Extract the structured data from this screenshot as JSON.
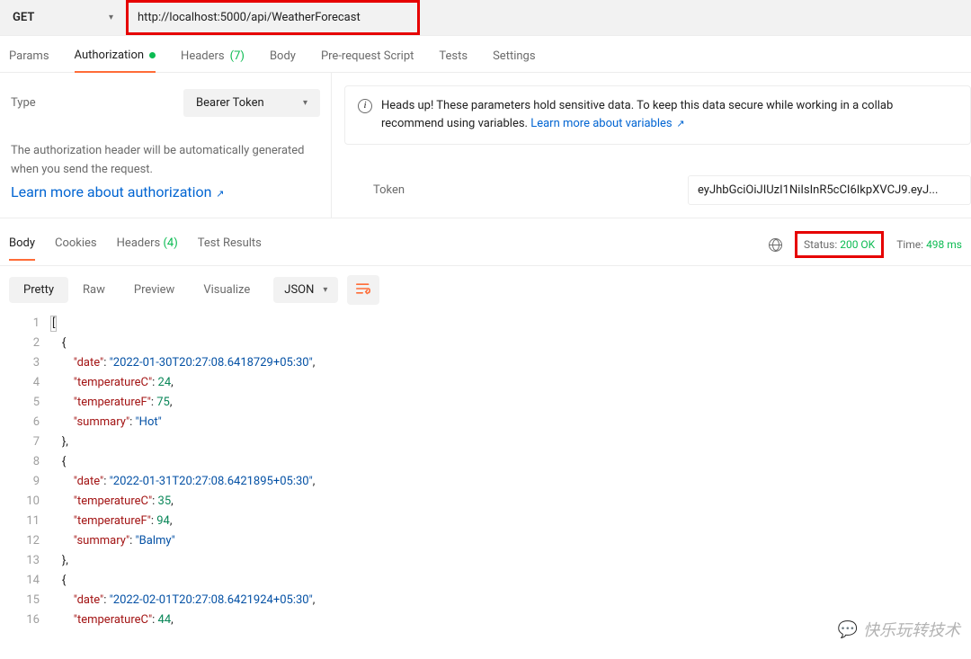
{
  "request": {
    "method": "GET",
    "url": "http://localhost:5000/api/WeatherForecast"
  },
  "req_tabs": {
    "params": "Params",
    "authorization": "Authorization",
    "headers": "Headers",
    "headers_count": "(7)",
    "body": "Body",
    "pre": "Pre-request Script",
    "tests": "Tests",
    "settings": "Settings"
  },
  "auth": {
    "type_label": "Type",
    "type_value": "Bearer Token",
    "desc": "The authorization header will be automatically generated when you send the request.",
    "learn_more": "Learn more about authorization",
    "notice": "Heads up! These parameters hold sensitive data. To keep this data secure while working in a collab recommend using variables.",
    "notice_link": "Learn more about variables",
    "token_label": "Token",
    "token_value": "eyJhbGciOiJIUzI1NiIsInR5cCI6IkpXVCJ9.eyJ..."
  },
  "resp_tabs": {
    "body": "Body",
    "cookies": "Cookies",
    "headers": "Headers",
    "headers_count": "(4)",
    "test_results": "Test Results"
  },
  "status": {
    "label": "Status:",
    "value": "200 OK",
    "time_label": "Time:",
    "time_value": "498 ms"
  },
  "view_controls": {
    "pretty": "Pretty",
    "raw": "Raw",
    "preview": "Preview",
    "visualize": "Visualize",
    "format": "JSON"
  },
  "code": {
    "lines": [
      {
        "n": 1,
        "html": "<span class='bracket-hl tok-punc'>[</span>"
      },
      {
        "n": 2,
        "html": "    <span class='tok-punc'>{</span>"
      },
      {
        "n": 3,
        "html": "        <span class='tok-key'>\"date\"</span><span class='tok-punc'>: </span><span class='tok-str'>\"2022-01-30T20:27:08.6418729+05:30\"</span><span class='tok-punc'>,</span>"
      },
      {
        "n": 4,
        "html": "        <span class='tok-key'>\"temperatureC\"</span><span class='tok-punc'>: </span><span class='tok-num'>24</span><span class='tok-punc'>,</span>"
      },
      {
        "n": 5,
        "html": "        <span class='tok-key'>\"temperatureF\"</span><span class='tok-punc'>: </span><span class='tok-num'>75</span><span class='tok-punc'>,</span>"
      },
      {
        "n": 6,
        "html": "        <span class='tok-key'>\"summary\"</span><span class='tok-punc'>: </span><span class='tok-str'>\"Hot\"</span>"
      },
      {
        "n": 7,
        "html": "    <span class='tok-punc'>},</span>"
      },
      {
        "n": 8,
        "html": "    <span class='tok-punc'>{</span>"
      },
      {
        "n": 9,
        "html": "        <span class='tok-key'>\"date\"</span><span class='tok-punc'>: </span><span class='tok-str'>\"2022-01-31T20:27:08.6421895+05:30\"</span><span class='tok-punc'>,</span>"
      },
      {
        "n": 10,
        "html": "        <span class='tok-key'>\"temperatureC\"</span><span class='tok-punc'>: </span><span class='tok-num'>35</span><span class='tok-punc'>,</span>"
      },
      {
        "n": 11,
        "html": "        <span class='tok-key'>\"temperatureF\"</span><span class='tok-punc'>: </span><span class='tok-num'>94</span><span class='tok-punc'>,</span>"
      },
      {
        "n": 12,
        "html": "        <span class='tok-key'>\"summary\"</span><span class='tok-punc'>: </span><span class='tok-str'>\"Balmy\"</span>"
      },
      {
        "n": 13,
        "html": "    <span class='tok-punc'>},</span>"
      },
      {
        "n": 14,
        "html": "    <span class='tok-punc'>{</span>"
      },
      {
        "n": 15,
        "html": "        <span class='tok-key'>\"date\"</span><span class='tok-punc'>: </span><span class='tok-str'>\"2022-02-01T20:27:08.6421924+05:30\"</span><span class='tok-punc'>,</span>"
      },
      {
        "n": 16,
        "html": "        <span class='tok-key'>\"temperatureC\"</span><span class='tok-punc'>: </span><span class='tok-num'>44</span><span class='tok-punc'>,</span>"
      }
    ]
  },
  "watermark": "快乐玩转技术"
}
